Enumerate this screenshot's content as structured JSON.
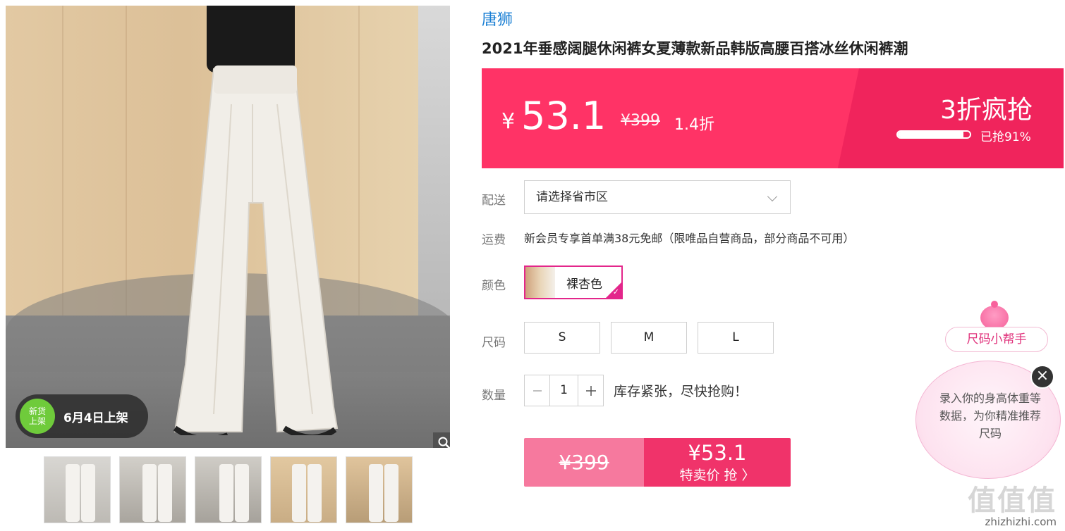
{
  "gallery": {
    "badge_line1": "新货",
    "badge_line2": "上架",
    "badge_text": "6月4日上架",
    "thumb_count": 5
  },
  "product": {
    "brand": "唐狮",
    "title": "2021年垂感阔腿休闲裤女夏薄款新品韩版高腰百搭冰丝休闲裤潮"
  },
  "price": {
    "currency": "¥",
    "current": "53.1",
    "original": "¥399",
    "discount": "1.4折",
    "promo_title": "3折疯抢",
    "sold_label": "已抢91%",
    "sold_fraction": 0.91,
    "accent_color": "#ff3366"
  },
  "delivery": {
    "label": "配送",
    "placeholder": "请选择省市区"
  },
  "freight": {
    "label": "运费",
    "text": "新会员专享首单满38元免邮（限唯品自营商品，部分商品不可用）"
  },
  "color": {
    "label": "颜色",
    "selected": "裸杏色"
  },
  "size": {
    "label": "尺码",
    "options": [
      "S",
      "M",
      "L"
    ]
  },
  "quantity": {
    "label": "数量",
    "value": "1",
    "stock_note": "库存紧张，尽快抢购！"
  },
  "buy": {
    "original": "¥399",
    "price": "¥53.1",
    "action": "特卖价 抢 〉"
  },
  "helper": {
    "tag": "尺码小帮手",
    "message": "录入你的身高体重等数据，为你精准推荐尺码"
  },
  "watermark": {
    "logo": "值值值",
    "url": "zhizhizhi.com"
  }
}
